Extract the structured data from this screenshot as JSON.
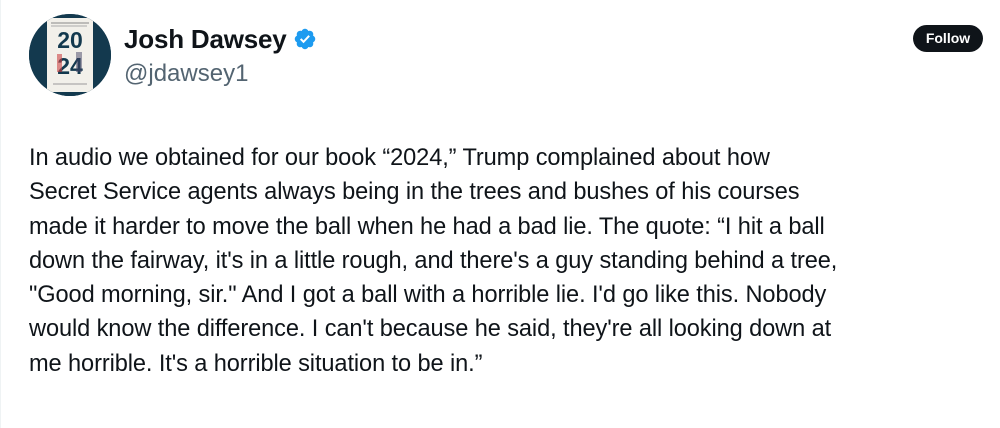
{
  "author": {
    "display_name": "Josh Dawsey",
    "handle": "@jdawsey1",
    "verified": true,
    "avatar_text_top": "20",
    "avatar_text_bottom": "24"
  },
  "actions": {
    "follow_label": "Follow"
  },
  "tweet": {
    "lines": [
      "In audio we obtained for our book “2024,” Trump complained about how",
      "Secret Service agents always being in the trees and bushes of his courses",
      "made it harder to move the ball when he had a bad lie.  The quote: “I hit a ball",
      "down the fairway, it's in a little rough, and there's a guy standing behind a tree,",
      "\"Good morning, sir.\" And I got a ball with a horrible lie. I'd go like this. Nobody",
      "would know the difference. I can't because he said, they're all looking down at",
      "me horrible. It's a horrible situation to be in.”"
    ]
  },
  "colors": {
    "text": "#0f1419",
    "secondary": "#536471",
    "verified": "#1d9bf0",
    "follow_bg": "#0f1419",
    "avatar_bg": "#13394e"
  },
  "icons": {
    "verified": "verified-badge-icon",
    "avatar": "book-cover-avatar"
  }
}
